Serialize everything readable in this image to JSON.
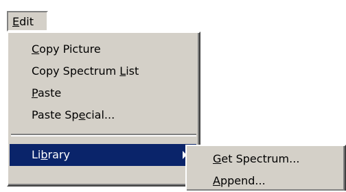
{
  "menubar": {
    "edit": {
      "pre": "",
      "key": "E",
      "post": "dit"
    }
  },
  "edit_menu": {
    "items": [
      {
        "pre": "",
        "key": "C",
        "post": "opy Picture"
      },
      {
        "pre": "Copy Spectrum ",
        "key": "L",
        "post": "ist"
      },
      {
        "pre": "",
        "key": "P",
        "post": "aste"
      },
      {
        "pre": "Paste Sp",
        "key": "e",
        "post": "cial..."
      },
      {
        "pre": "Li",
        "key": "b",
        "post": "rary"
      }
    ]
  },
  "library_submenu": {
    "items": [
      {
        "pre": "",
        "key": "G",
        "post": "et Spectrum..."
      },
      {
        "pre": "",
        "key": "A",
        "post": "ppend..."
      }
    ]
  },
  "colors": {
    "menu_face": "#d4d0c8",
    "highlight": "#0a246a",
    "highlight_text": "#ffffff"
  }
}
